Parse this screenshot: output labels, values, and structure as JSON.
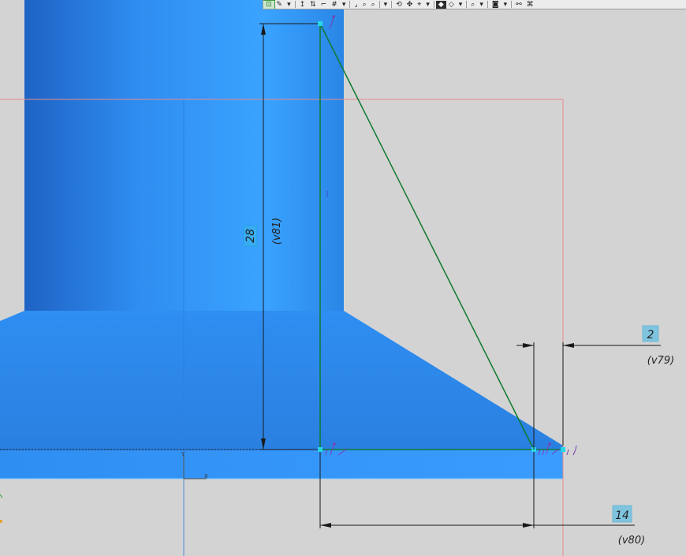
{
  "toolbar": {
    "buttons": [
      {
        "name": "sketch-toggle-button",
        "glyph": "⊡",
        "active": true
      },
      {
        "name": "pencil-tool-button",
        "glyph": "✎",
        "active": false
      },
      {
        "name": "dropdown-arrow-1",
        "glyph": "▾",
        "active": false
      },
      {
        "name": "axis-labels-button",
        "glyph": "↥",
        "active": false
      },
      {
        "name": "ortho-button",
        "glyph": "⇅",
        "active": false
      },
      {
        "name": "bracket-button",
        "glyph": "⌐",
        "active": false
      },
      {
        "name": "grid-button",
        "glyph": "#",
        "active": false
      },
      {
        "name": "dropdown-arrow-2",
        "glyph": "▾",
        "active": false
      },
      {
        "name": "bracket-close-button",
        "glyph": "⌟",
        "active": false
      },
      {
        "name": "zoom-button",
        "glyph": "⌕",
        "active": false
      },
      {
        "name": "zoom-dropdown-button",
        "glyph": "⌕",
        "active": false
      },
      {
        "name": "dropdown-arrow-3",
        "glyph": "▾",
        "active": false
      },
      {
        "name": "rotate-button",
        "glyph": "⟲",
        "active": false
      },
      {
        "name": "pan-button",
        "glyph": "✥",
        "active": false
      },
      {
        "name": "orient-button",
        "glyph": "⌖",
        "active": false
      },
      {
        "name": "dropdown-arrow-4",
        "glyph": "▾",
        "active": false
      },
      {
        "name": "shaded-view-button",
        "glyph": "◆",
        "active": false,
        "dark": true
      },
      {
        "name": "wireframe-view-button",
        "glyph": "◇",
        "active": false
      },
      {
        "name": "dropdown-arrow-5",
        "glyph": "▾",
        "active": false
      },
      {
        "name": "section-button",
        "glyph": "⌕",
        "active": false
      },
      {
        "name": "dropdown-arrow-6",
        "glyph": "▾",
        "active": false
      },
      {
        "name": "display-button",
        "glyph": "◙",
        "active": false
      },
      {
        "name": "dropdown-arrow-7",
        "glyph": "▾",
        "active": false
      },
      {
        "name": "constraints-button",
        "glyph": "⚯",
        "active": false
      },
      {
        "name": "parametric-button",
        "glyph": "⌘",
        "active": false
      }
    ]
  },
  "dimensions": {
    "vertical": {
      "value": "28",
      "variable": "(v81)"
    },
    "horizontal_top": {
      "value": "2",
      "variable": "(v79)"
    },
    "horizontal_bottom": {
      "value": "14",
      "variable": "(v80)"
    }
  },
  "axes": {
    "y_label": "Y",
    "x_label": "X"
  },
  "colors": {
    "part_fill": "#2f8cf0",
    "part_light": "#3da2ff",
    "part_dark": "#1f66c8",
    "sketch_line": "#0e7a2e",
    "dimension_line": "#1a1a1a",
    "sketch_frame": "#e88a8a",
    "point": "#26d6e8",
    "constraint_glyph": "#7a3fb0",
    "background": "#d2d2d2"
  }
}
